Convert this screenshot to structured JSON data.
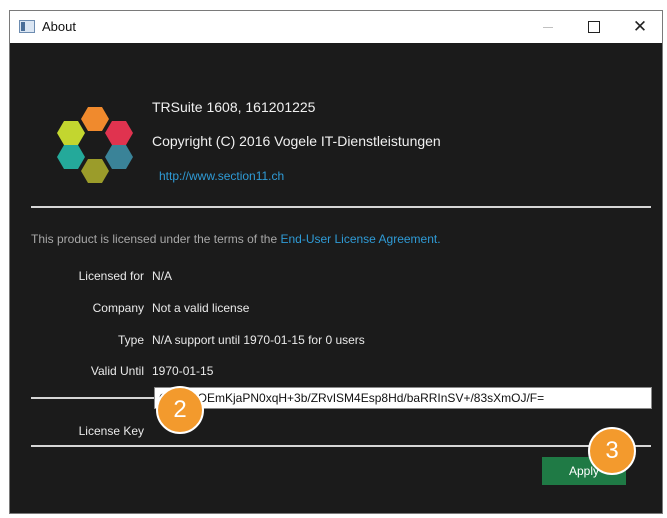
{
  "window": {
    "title": "About"
  },
  "about": {
    "product": "TRSuite 1608, 161201225",
    "copyright": "Copyright (C) 2016 Vogele IT-Dienstleistungen",
    "website": "http://www.section11.ch"
  },
  "license": {
    "terms_text": "This product is licensed under the terms of the",
    "eula_link": "End-User License Agreement.",
    "fields": [
      {
        "label": "Licensed for",
        "value": "N/A"
      },
      {
        "label": "Company",
        "value": "Not a valid license"
      },
      {
        "label": "Type",
        "value": "N/A support until 1970-01-15 for 0 users"
      },
      {
        "label": "Valid Until",
        "value": "1970-01-15"
      }
    ],
    "key_label": "License Key",
    "key_value": "CLZTROEmKjaPN0xqH+3b/ZRvISM4Esp8Hd/baRRInSV+/83sXmOJ/F="
  },
  "buttons": {
    "apply": "Apply"
  },
  "annotations": {
    "badge_2": "2",
    "badge_3": "3"
  },
  "colors": {
    "background": "#1b1b1b",
    "link": "#2f9bd6",
    "apply_button": "#1f7a45",
    "badge": "#f39a2d"
  }
}
